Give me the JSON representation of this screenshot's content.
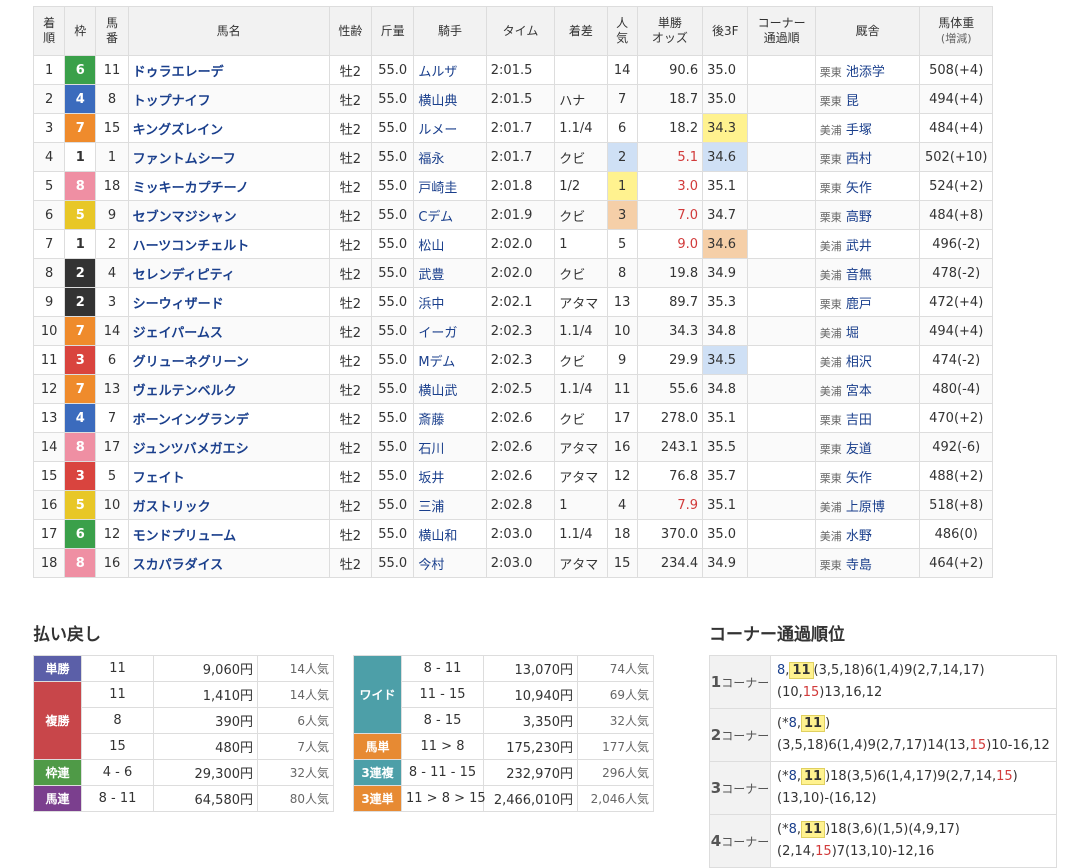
{
  "result_headers": {
    "rank": [
      "着",
      "順"
    ],
    "waku": "枠",
    "num": [
      "馬",
      "番"
    ],
    "name": "馬名",
    "sex_age": "性齢",
    "weight": "斤量",
    "jockey": "騎手",
    "time": "タイム",
    "margin": "着差",
    "pop": [
      "人",
      "気"
    ],
    "odds": [
      "単勝",
      "オッズ"
    ],
    "last3f": "後3F",
    "corner": [
      "コーナー",
      "通過順"
    ],
    "stable": "厩舎",
    "body": [
      "馬体重",
      "(増減)"
    ]
  },
  "rows": [
    {
      "rank": "1",
      "waku": "6",
      "num": "11",
      "name": "ドゥラエレーデ",
      "sa": "牡2",
      "wt": "55.0",
      "jockey": "ムルザ",
      "time": "2:01.5",
      "margin": "",
      "pop": "14",
      "odds": "90.6",
      "f3": "35.0",
      "corner": "",
      "region": "栗東",
      "trainer": "池添学",
      "body": "508(+4)"
    },
    {
      "rank": "2",
      "waku": "4",
      "num": "8",
      "name": "トップナイフ",
      "sa": "牡2",
      "wt": "55.0",
      "jockey": "横山典",
      "time": "2:01.5",
      "margin": "ハナ",
      "pop": "7",
      "odds": "18.7",
      "f3": "35.0",
      "corner": "",
      "region": "栗東",
      "trainer": "昆",
      "body": "494(+4)"
    },
    {
      "rank": "3",
      "waku": "7",
      "num": "15",
      "name": "キングズレイン",
      "sa": "牡2",
      "wt": "55.0",
      "jockey": "ルメー",
      "time": "2:01.7",
      "margin": "1.1/4",
      "pop": "6",
      "odds": "18.2",
      "f3": "34.3",
      "corner": "",
      "region": "美浦",
      "trainer": "手塚",
      "body": "484(+4)"
    },
    {
      "rank": "4",
      "waku": "1",
      "num": "1",
      "name": "ファントムシーフ",
      "sa": "牡2",
      "wt": "55.0",
      "jockey": "福永",
      "time": "2:01.7",
      "margin": "クビ",
      "pop": "2",
      "odds": "5.1",
      "f3": "34.6",
      "corner": "",
      "region": "栗東",
      "trainer": "西村",
      "body": "502(+10)"
    },
    {
      "rank": "5",
      "waku": "8",
      "num": "18",
      "name": "ミッキーカプチーノ",
      "sa": "牡2",
      "wt": "55.0",
      "jockey": "戸崎圭",
      "time": "2:01.8",
      "margin": "1/2",
      "pop": "1",
      "odds": "3.0",
      "f3": "35.1",
      "corner": "",
      "region": "栗東",
      "trainer": "矢作",
      "body": "524(+2)"
    },
    {
      "rank": "6",
      "waku": "5",
      "num": "9",
      "name": "セブンマジシャン",
      "sa": "牡2",
      "wt": "55.0",
      "jockey": "Cデム",
      "time": "2:01.9",
      "margin": "クビ",
      "pop": "3",
      "odds": "7.0",
      "f3": "34.7",
      "corner": "",
      "region": "栗東",
      "trainer": "高野",
      "body": "484(+8)"
    },
    {
      "rank": "7",
      "waku": "1",
      "num": "2",
      "name": "ハーツコンチェルト",
      "sa": "牡2",
      "wt": "55.0",
      "jockey": "松山",
      "time": "2:02.0",
      "margin": "1",
      "pop": "5",
      "odds": "9.0",
      "f3": "34.6",
      "corner": "",
      "region": "美浦",
      "trainer": "武井",
      "body": "496(-2)"
    },
    {
      "rank": "8",
      "waku": "2",
      "num": "4",
      "name": "セレンディピティ",
      "sa": "牡2",
      "wt": "55.0",
      "jockey": "武豊",
      "time": "2:02.0",
      "margin": "クビ",
      "pop": "8",
      "odds": "19.8",
      "f3": "34.9",
      "corner": "",
      "region": "美浦",
      "trainer": "音無",
      "body": "478(-2)"
    },
    {
      "rank": "9",
      "waku": "2",
      "num": "3",
      "name": "シーウィザード",
      "sa": "牡2",
      "wt": "55.0",
      "jockey": "浜中",
      "time": "2:02.1",
      "margin": "アタマ",
      "pop": "13",
      "odds": "89.7",
      "f3": "35.3",
      "corner": "",
      "region": "栗東",
      "trainer": "鹿戸",
      "body": "472(+4)"
    },
    {
      "rank": "10",
      "waku": "7",
      "num": "14",
      "name": "ジェイパームス",
      "sa": "牡2",
      "wt": "55.0",
      "jockey": "イーガ",
      "time": "2:02.3",
      "margin": "1.1/4",
      "pop": "10",
      "odds": "34.3",
      "f3": "34.8",
      "corner": "",
      "region": "美浦",
      "trainer": "堀",
      "body": "494(+4)"
    },
    {
      "rank": "11",
      "waku": "3",
      "num": "6",
      "name": "グリューネグリーン",
      "sa": "牡2",
      "wt": "55.0",
      "jockey": "Mデム",
      "time": "2:02.3",
      "margin": "クビ",
      "pop": "9",
      "odds": "29.9",
      "f3": "34.5",
      "corner": "",
      "region": "美浦",
      "trainer": "相沢",
      "body": "474(-2)"
    },
    {
      "rank": "12",
      "waku": "7",
      "num": "13",
      "name": "ヴェルテンベルク",
      "sa": "牡2",
      "wt": "55.0",
      "jockey": "横山武",
      "time": "2:02.5",
      "margin": "1.1/4",
      "pop": "11",
      "odds": "55.6",
      "f3": "34.8",
      "corner": "",
      "region": "美浦",
      "trainer": "宮本",
      "body": "480(-4)"
    },
    {
      "rank": "13",
      "waku": "4",
      "num": "7",
      "name": "ボーンイングランデ",
      "sa": "牡2",
      "wt": "55.0",
      "jockey": "斎藤",
      "time": "2:02.6",
      "margin": "クビ",
      "pop": "17",
      "odds": "278.0",
      "f3": "35.1",
      "corner": "",
      "region": "栗東",
      "trainer": "吉田",
      "body": "470(+2)"
    },
    {
      "rank": "14",
      "waku": "8",
      "num": "17",
      "name": "ジュンツバメガエシ",
      "sa": "牡2",
      "wt": "55.0",
      "jockey": "石川",
      "time": "2:02.6",
      "margin": "アタマ",
      "pop": "16",
      "odds": "243.1",
      "f3": "35.5",
      "corner": "",
      "region": "栗東",
      "trainer": "友道",
      "body": "492(-6)"
    },
    {
      "rank": "15",
      "waku": "3",
      "num": "5",
      "name": "フェイト",
      "sa": "牡2",
      "wt": "55.0",
      "jockey": "坂井",
      "time": "2:02.6",
      "margin": "アタマ",
      "pop": "12",
      "odds": "76.8",
      "f3": "35.7",
      "corner": "",
      "region": "栗東",
      "trainer": "矢作",
      "body": "488(+2)"
    },
    {
      "rank": "16",
      "waku": "5",
      "num": "10",
      "name": "ガストリック",
      "sa": "牡2",
      "wt": "55.0",
      "jockey": "三浦",
      "time": "2:02.8",
      "margin": "1",
      "pop": "4",
      "odds": "7.9",
      "f3": "35.1",
      "corner": "",
      "region": "美浦",
      "trainer": "上原博",
      "body": "518(+8)"
    },
    {
      "rank": "17",
      "waku": "6",
      "num": "12",
      "name": "モンドプリューム",
      "sa": "牡2",
      "wt": "55.0",
      "jockey": "横山和",
      "time": "2:03.0",
      "margin": "1.1/4",
      "pop": "18",
      "odds": "370.0",
      "f3": "35.0",
      "corner": "",
      "region": "美浦",
      "trainer": "水野",
      "body": "486(0)"
    },
    {
      "rank": "18",
      "waku": "8",
      "num": "16",
      "name": "スカパラダイス",
      "sa": "牡2",
      "wt": "55.0",
      "jockey": "今村",
      "time": "2:03.0",
      "margin": "アタマ",
      "pop": "15",
      "odds": "234.4",
      "f3": "34.9",
      "corner": "",
      "region": "栗東",
      "trainer": "寺島",
      "body": "464(+2)"
    }
  ],
  "colors": {
    "waku_1": "#ffffff",
    "waku_2": "#333333",
    "waku_3": "#d9443e",
    "waku_4": "#3b6bbd",
    "waku_5": "#e8c727",
    "waku_6": "#3aa04a",
    "waku_7": "#ef8b2c",
    "waku_8": "#ef8fa3",
    "odds_red": "#d13a3a",
    "pop1_bg": "#fff28f",
    "pop2_bg": "#cfe0f5",
    "pop3_bg": "#f5cfa8"
  },
  "payout_title": "払い戻し",
  "payout_left": [
    {
      "label": "単勝",
      "cls": "tan",
      "entries": [
        {
          "num": "11",
          "yen": "9,060円",
          "pop": "14人気"
        }
      ]
    },
    {
      "label": "複勝",
      "cls": "fuku",
      "entries": [
        {
          "num": "11",
          "yen": "1,410円",
          "pop": "14人気"
        },
        {
          "num": "8",
          "yen": "390円",
          "pop": "6人気"
        },
        {
          "num": "15",
          "yen": "480円",
          "pop": "7人気"
        }
      ]
    },
    {
      "label": "枠連",
      "cls": "waku",
      "entries": [
        {
          "num": "4 - 6",
          "yen": "29,300円",
          "pop": "32人気"
        }
      ]
    },
    {
      "label": "馬連",
      "cls": "uren",
      "entries": [
        {
          "num": "8 - 11",
          "yen": "64,580円",
          "pop": "80人気"
        }
      ]
    }
  ],
  "payout_right": [
    {
      "label": "ワイド",
      "cls": "wide",
      "entries": [
        {
          "num": "8 - 11",
          "yen": "13,070円",
          "pop": "74人気"
        },
        {
          "num": "11 - 15",
          "yen": "10,940円",
          "pop": "69人気"
        },
        {
          "num": "8 - 15",
          "yen": "3,350円",
          "pop": "32人気"
        }
      ]
    },
    {
      "label": "馬単",
      "cls": "utan",
      "entries": [
        {
          "num": "11 > 8",
          "yen": "175,230円",
          "pop": "177人気"
        }
      ]
    },
    {
      "label": "3連複",
      "cls": "fuku3",
      "entries": [
        {
          "num": "8 - 11 - 15",
          "yen": "232,970円",
          "pop": "296人気"
        }
      ]
    },
    {
      "label": "3連単",
      "cls": "tan3",
      "entries": [
        {
          "num": "11 > 8 > 15",
          "yen": "2,466,010円",
          "pop": "2,046人気"
        }
      ]
    }
  ],
  "corner_title": "コーナー通過順位",
  "corner_suffix": "コーナー",
  "corners": [
    {
      "n": "1",
      "parts": [
        {
          "t": "8",
          "c": "b"
        },
        {
          "t": ",",
          "c": ""
        },
        {
          "t": "11",
          "c": "hl"
        },
        {
          "t": "(3,5,18)6(1,4)9(2,7,14,17)",
          "c": ""
        },
        {
          "t": "(10,",
          "c": ""
        },
        {
          "t": "15",
          "c": "rd"
        },
        {
          "t": ")13,16,12",
          "c": ""
        }
      ]
    },
    {
      "n": "2",
      "parts": [
        {
          "t": "(*",
          "c": ""
        },
        {
          "t": "8",
          "c": "b"
        },
        {
          "t": ",",
          "c": ""
        },
        {
          "t": "11",
          "c": "hl"
        },
        {
          "t": ")(3,5,18)6(1,4)9(2,7,17)14(13,",
          "c": ""
        },
        {
          "t": "15",
          "c": "rd"
        },
        {
          "t": ")10-16,12",
          "c": ""
        }
      ]
    },
    {
      "n": "3",
      "parts": [
        {
          "t": "(*",
          "c": ""
        },
        {
          "t": "8",
          "c": "b"
        },
        {
          "t": ",",
          "c": ""
        },
        {
          "t": "11",
          "c": "hl"
        },
        {
          "t": ")18(3,5)6(1,4,17)9(2,7,14,",
          "c": ""
        },
        {
          "t": "15",
          "c": "rd"
        },
        {
          "t": ")(13,10)-(16,12)",
          "c": ""
        }
      ]
    },
    {
      "n": "4",
      "parts": [
        {
          "t": "(*",
          "c": ""
        },
        {
          "t": "8",
          "c": "b"
        },
        {
          "t": ",",
          "c": ""
        },
        {
          "t": "11",
          "c": "hl"
        },
        {
          "t": ")18(3,6)(1,5)(4,9,17)(2,14,",
          "c": ""
        },
        {
          "t": "15",
          "c": "rd"
        },
        {
          "t": ")7(13,10)-12,16",
          "c": ""
        }
      ]
    }
  ]
}
